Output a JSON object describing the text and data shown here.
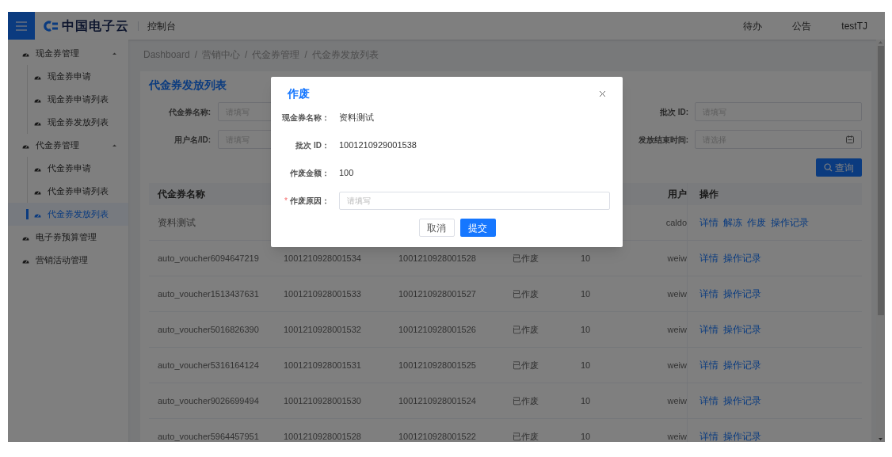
{
  "header": {
    "logo_text": "中国电子云",
    "app_name": "控制台",
    "links": [
      "待办",
      "公告"
    ],
    "user": "testTJ"
  },
  "sidebar": {
    "items": [
      {
        "label": "现金券管理",
        "expanded": true,
        "selected": false,
        "children": [
          {
            "label": "现金券申请",
            "selected": false
          },
          {
            "label": "现金券申请列表",
            "selected": false
          },
          {
            "label": "现金券发放列表",
            "selected": false
          }
        ]
      },
      {
        "label": "代金券管理",
        "expanded": true,
        "selected": false,
        "children": [
          {
            "label": "代金券申请",
            "selected": false
          },
          {
            "label": "代金券申请列表",
            "selected": false
          },
          {
            "label": "代金券发放列表",
            "selected": true
          }
        ]
      },
      {
        "label": "电子券预算管理",
        "selected": false
      },
      {
        "label": "营销活动管理",
        "selected": false
      }
    ]
  },
  "breadcrumb": {
    "separator": "/",
    "items": [
      "Dashboard",
      "营销中心",
      "代金券管理",
      "代金券发放列表"
    ]
  },
  "card": {
    "title": "代金券发放列表",
    "filters": {
      "left": [
        {
          "label": "代金券名称:",
          "placeholder": "请填写",
          "kind": "text"
        },
        {
          "label": "用户名/ID:",
          "placeholder": "请填写",
          "kind": "text"
        }
      ],
      "right": [
        {
          "label": "批次 ID:",
          "placeholder": "请填写",
          "kind": "text"
        },
        {
          "label": "发放结束时间:",
          "placeholder": "请选择",
          "kind": "date"
        }
      ]
    },
    "search_button": "查询"
  },
  "table": {
    "columns": {
      "name": "代金券名称",
      "user": "用户",
      "actions": "操作"
    },
    "rows": [
      {
        "name": "资料测试",
        "user": "caldo",
        "actions": [
          "详情",
          "解冻",
          "作废",
          "操作记录"
        ]
      },
      {
        "name": "auto_voucher6094647219",
        "column_2": "1001210928001534",
        "column_3": "1001210928001528",
        "column_4": "已作废",
        "column_5": "10",
        "user": "weiw",
        "actions": [
          "详情",
          "操作记录"
        ]
      },
      {
        "name": "auto_voucher1513437631",
        "column_2": "1001210928001533",
        "column_3": "1001210928001527",
        "column_4": "已作废",
        "column_5": "10",
        "user": "weiw",
        "actions": [
          "详情",
          "操作记录"
        ]
      },
      {
        "name": "auto_voucher5016826390",
        "column_2": "1001210928001532",
        "column_3": "1001210928001526",
        "column_4": "已作废",
        "column_5": "10",
        "user": "weiw",
        "actions": [
          "详情",
          "操作记录"
        ]
      },
      {
        "name": "auto_voucher5316164124",
        "column_2": "1001210928001531",
        "column_3": "1001210928001525",
        "column_4": "已作废",
        "column_5": "10",
        "user": "weiw",
        "actions": [
          "详情",
          "操作记录"
        ]
      },
      {
        "name": "auto_voucher9026699494",
        "column_2": "1001210928001530",
        "column_3": "1001210928001524",
        "column_4": "已作废",
        "column_5": "10",
        "user": "weiw",
        "actions": [
          "详情",
          "操作记录"
        ]
      },
      {
        "name": "auto_voucher5964457951",
        "column_2": "1001210928001528",
        "column_3": "1001210928001522",
        "column_4": "已作废",
        "column_5": "10",
        "user": "weiw",
        "actions": [
          "详情",
          "操作记录"
        ]
      }
    ]
  },
  "modal": {
    "title": "作废",
    "fields": [
      {
        "kind": "text",
        "label": "现金券名称：",
        "value": "资料测试"
      },
      {
        "kind": "text",
        "label": "批次 ID：",
        "value": "1001210929001538"
      },
      {
        "kind": "text",
        "label": "作废金额：",
        "value": "100"
      },
      {
        "kind": "input",
        "label": "作废原因：",
        "placeholder": "请填写",
        "required_mark": "*"
      }
    ],
    "buttons": [
      {
        "label": "取消",
        "kind": "secondary"
      },
      {
        "label": "提交",
        "kind": "primary"
      }
    ]
  }
}
